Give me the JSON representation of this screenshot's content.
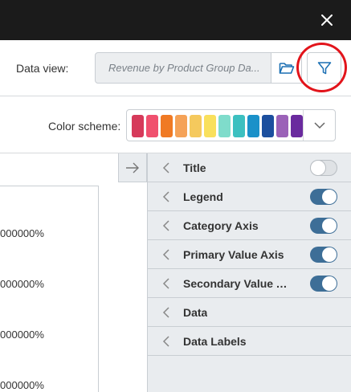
{
  "window": {
    "close_icon": "close-icon"
  },
  "data_view": {
    "label": "Data view:",
    "value": "Revenue by Product Group Da...",
    "folder_icon": "folder-open-icon",
    "filter_icon": "filter-icon",
    "highlight_color": "#e2141b"
  },
  "color_scheme": {
    "label": "Color scheme:",
    "swatches": [
      "#d63a5a",
      "#f0506e",
      "#f07a24",
      "#f5a257",
      "#f5c95d",
      "#f9e05c",
      "#7fdccb",
      "#3cc0c0",
      "#1a91c9",
      "#1c4f9e",
      "#9b62b8",
      "#6a2a9e"
    ]
  },
  "chart": {
    "tick_labels": [
      "000000%",
      "000000%",
      "000000%",
      "000000%"
    ]
  },
  "panel": {
    "collapse_icon": "arrow-right-icon",
    "accent_color": "#3d6e97",
    "items": [
      {
        "label": "Title",
        "toggle": false
      },
      {
        "label": "Legend",
        "toggle": true
      },
      {
        "label": "Category Axis",
        "toggle": true
      },
      {
        "label": "Primary Value Axis",
        "toggle": true
      },
      {
        "label": "Secondary Value A...",
        "toggle": true
      },
      {
        "label": "Data"
      },
      {
        "label": "Data Labels"
      }
    ]
  }
}
